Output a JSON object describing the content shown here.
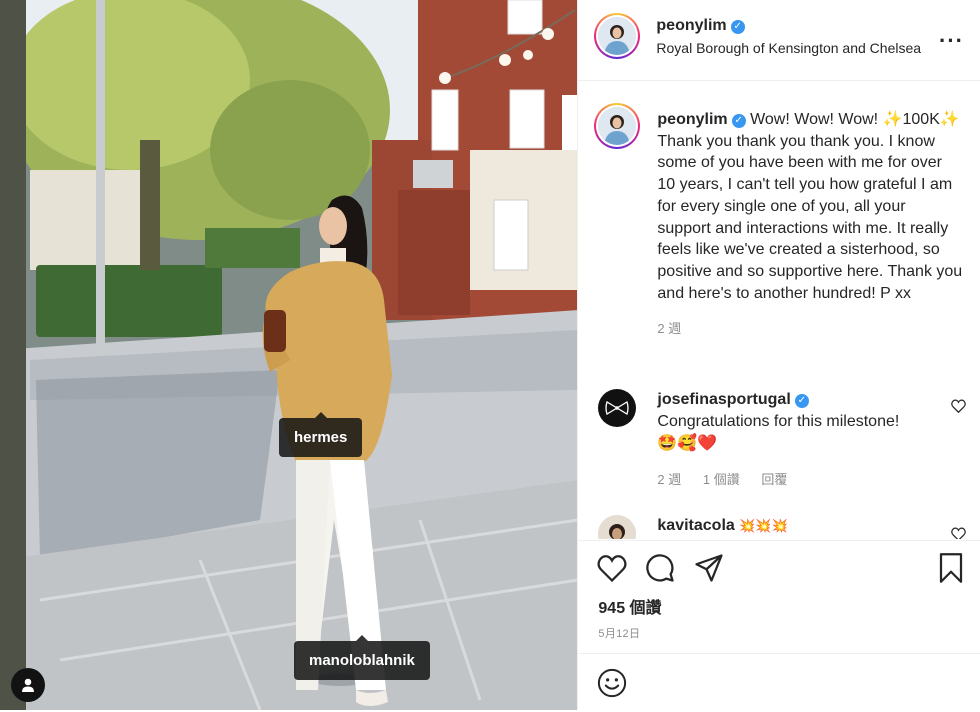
{
  "post": {
    "username": "peonylim",
    "location": "Royal Borough of Kensington and Chelsea",
    "caption_prefix": "Wow! Wow! Wow!",
    "caption_body": "✨100K✨ Thank you thank you thank you. I know some of you have been with me for over 10 years, I can't tell you how grateful I am for every single one of you, all your support and interactions with me. It really feels like we've created a sisterhood, so positive and so supportive here. Thank you and here's to another hundred! P xx",
    "caption_age": "2 週",
    "likes": "945 個讚",
    "date": "5月12日"
  },
  "tags": {
    "first": "hermes",
    "second": "manoloblahnik"
  },
  "comments": [
    {
      "username": "josefinasportugal",
      "text": "Congratulations for this milestone!",
      "emoji": "🤩🥰❤️",
      "age": "2 週",
      "likes": "1 個讚",
      "reply": "回覆"
    },
    {
      "username": "kavitacola",
      "text": "💥💥💥"
    }
  ],
  "icons": [
    "user-tag-icon",
    "more-options-icon",
    "verified-icon",
    "heart-icon",
    "comment-icon",
    "share-icon",
    "bookmark-icon",
    "emoji-icon"
  ],
  "colors": {
    "verified": "#3897f0",
    "text": "#262626",
    "muted": "#8e8e8e",
    "border": "#efefef"
  }
}
